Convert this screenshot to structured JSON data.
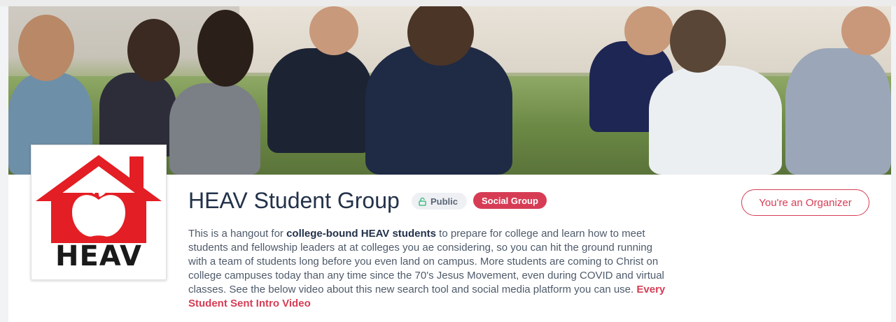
{
  "group": {
    "title": "HEAV Student Group",
    "visibility_label": "Public",
    "type_label": "Social Group",
    "organizer_label": "You're an Organizer",
    "logo_text": "HEAV"
  },
  "description": {
    "part1": "This is a hangout for ",
    "bold": "college-bound HEAV students",
    "part2": " to prepare for college and learn how to meet students and fellowship leaders at at colleges you ae considering, so you can hit the ground running with a team of students long before you even land on campus. More students are coming to Christ on college campuses today than any time since the 70's Jesus Movement, even during COVID and virtual classes.  See the below video about this new search tool and social media platform you can use. ",
    "link_text": "Every Student Sent Intro Video"
  },
  "colors": {
    "accent": "#d63d55",
    "title": "#23324a",
    "logo_red": "#e31e24"
  },
  "icons": {
    "visibility": "lock-icon"
  }
}
